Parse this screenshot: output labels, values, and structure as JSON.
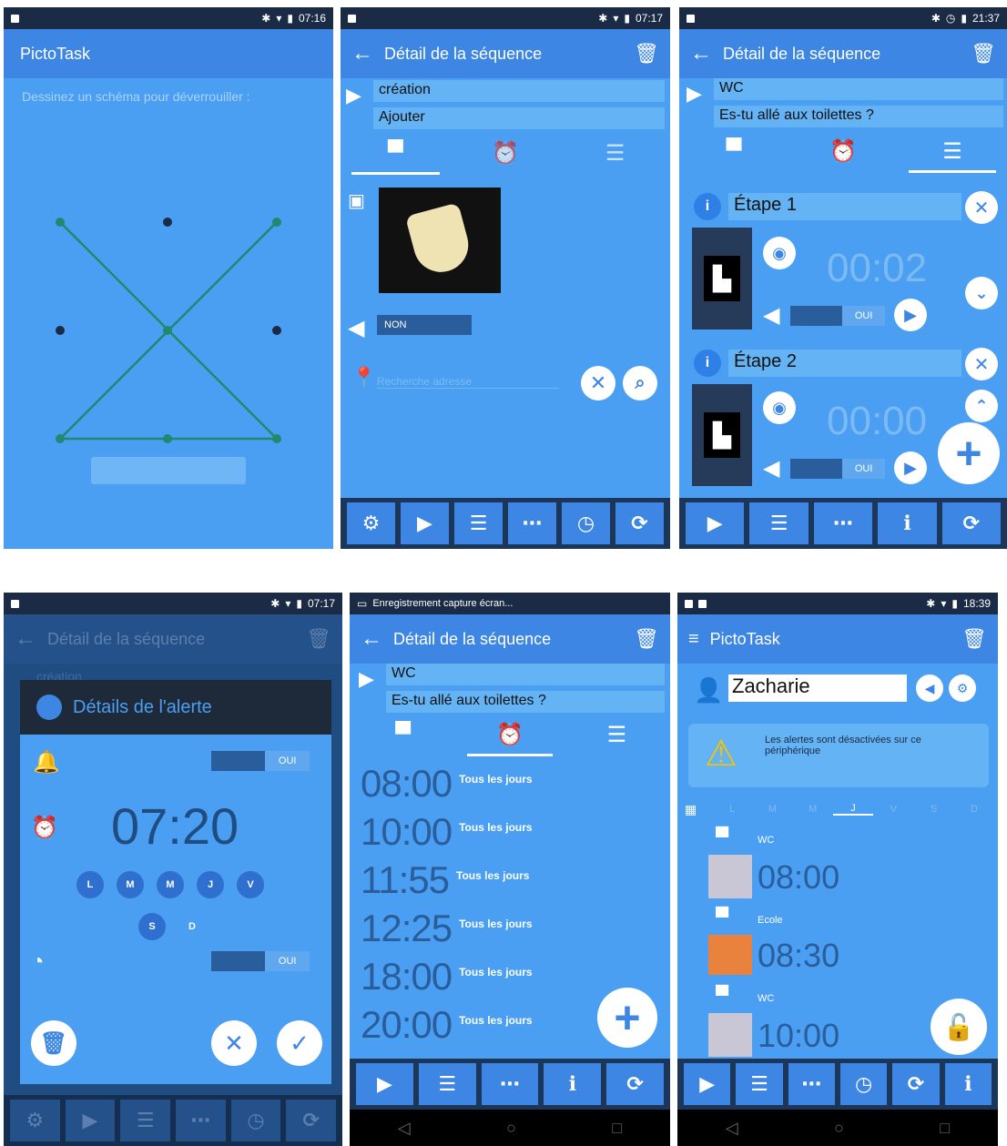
{
  "s1": {
    "status_time": "07:16",
    "app_title": "PictoTask",
    "instruction": "Dessinez un schéma pour déverrouiller :"
  },
  "s2": {
    "status_time": "07:17",
    "title": "Détail de la séquence",
    "name_value": "création",
    "sub_value": "Ajouter",
    "sound_value": "NON",
    "location_placeholder": "Recherche adresse"
  },
  "s3": {
    "status_time": "21:37",
    "title": "Détail de la séquence",
    "name_value": "WC",
    "sub_value": "Es-tu allé aux toilettes ?",
    "steps": [
      {
        "label": "Étape 1",
        "time": "00:02",
        "sound": "OUI"
      },
      {
        "label": "Étape 2",
        "time": "00:00",
        "sound": "OUI"
      }
    ]
  },
  "s4": {
    "status_time": "07:17",
    "bg_title": "Détail de la séquence",
    "bg_field": "création",
    "dialog_title": "Détails de l'alerte",
    "toggle1": "OUI",
    "time": "07:20",
    "days_row1": [
      "L",
      "M",
      "M",
      "J",
      "V"
    ],
    "days_row2": [
      "S",
      "D"
    ],
    "toggle2": "OUI"
  },
  "s5": {
    "status_text": "Enregistrement capture écran...",
    "title": "Détail de la séquence",
    "name_value": "WC",
    "sub_value": "Es-tu allé aux toilettes ?",
    "alarms": [
      {
        "time": "08:00",
        "label": "Tous les jours"
      },
      {
        "time": "10:00",
        "label": "Tous les jours"
      },
      {
        "time": "11:55",
        "label": "Tous les jours"
      },
      {
        "time": "12:25",
        "label": "Tous les jours"
      },
      {
        "time": "18:00",
        "label": "Tous les jours"
      },
      {
        "time": "20:00",
        "label": "Tous les jours"
      }
    ]
  },
  "s6": {
    "status_time": "18:39",
    "app_title": "PictoTask",
    "user_name": "Zacharie",
    "warning": "Les alertes sont désactivées sur ce périphérique",
    "day_tabs": [
      "L",
      "M",
      "M",
      "J",
      "V",
      "S",
      "D"
    ],
    "items": [
      {
        "name": "WC",
        "time": "08:00"
      },
      {
        "name": "Ecole",
        "time": "08:30"
      },
      {
        "name": "WC",
        "time": "10:00"
      }
    ]
  },
  "colors": {
    "background": "#4a9ff2",
    "appbar": "#3d86e3",
    "bottombar": "#1b3658",
    "statusbar": "#1b2b45",
    "pattern_line": "#1f8a6e"
  }
}
